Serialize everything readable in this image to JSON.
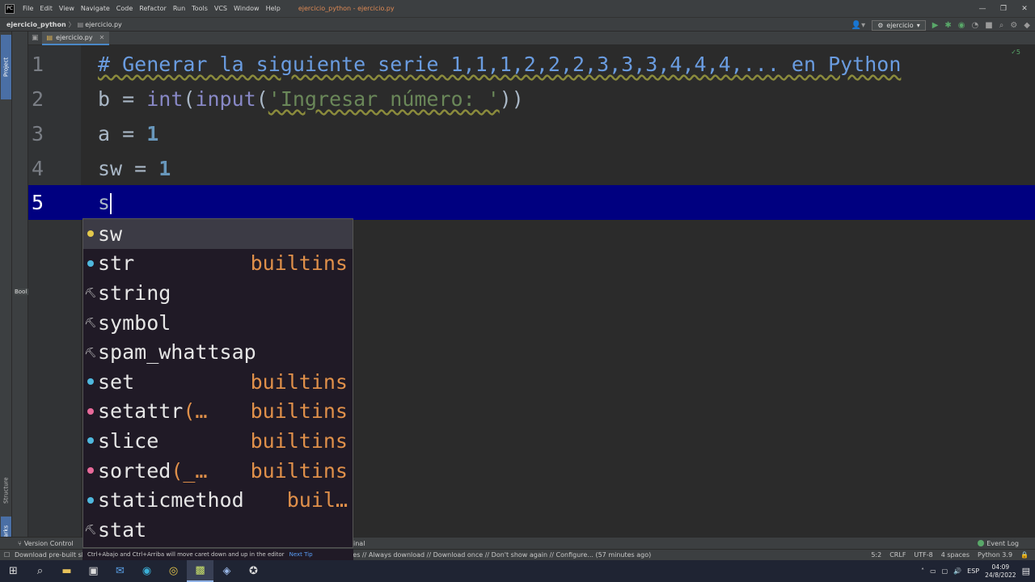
{
  "titlebar": {
    "app_icon": "PC",
    "menu": [
      "File",
      "Edit",
      "View",
      "Navigate",
      "Code",
      "Refactor",
      "Run",
      "Tools",
      "VCS",
      "Window",
      "Help"
    ],
    "window_title": "ejercicio_python - ejercicio.py"
  },
  "navbar": {
    "project": "ejercicio_python",
    "file": "ejercicio.py",
    "run_config": "ejercicio"
  },
  "left_strip": {
    "project_tab": "Project",
    "structure_tab": "Structure",
    "bookmarks_tab": "Bookmarks",
    "bookmarks_panel": "Bool"
  },
  "editor_tab": {
    "label": "ejercicio.py"
  },
  "editor": {
    "inspection": "✓5",
    "lines": [
      {
        "num": "1",
        "code": "# Generar la siguiente serie 1,1,1,2,2,2,3,3,3,4,4,4,... en Python"
      },
      {
        "num": "2",
        "p1": "b = ",
        "p2": "int",
        "p3": "(",
        "p4": "input",
        "p5": "(",
        "p6": "'Ingresar número: '",
        "p7": "))"
      },
      {
        "num": "3",
        "p1": "a = ",
        "p2": "1"
      },
      {
        "num": "4",
        "p1": "sw = ",
        "p2": "1"
      },
      {
        "num": "5",
        "p1": "s"
      }
    ]
  },
  "completion": {
    "items": [
      {
        "name": "sw",
        "tail": "",
        "type": "",
        "kind": "variable"
      },
      {
        "name": "str",
        "tail": "",
        "type": "builtins",
        "kind": "class"
      },
      {
        "name": "string",
        "tail": "",
        "type": "",
        "kind": "module"
      },
      {
        "name": "symbol",
        "tail": "",
        "type": "",
        "kind": "module"
      },
      {
        "name": "spam_whattsap",
        "tail": "",
        "type": "",
        "kind": "module"
      },
      {
        "name": "set",
        "tail": "",
        "type": "builtins",
        "kind": "class"
      },
      {
        "name": "setattr",
        "tail": "(…",
        "type": "builtins",
        "kind": "function"
      },
      {
        "name": "slice",
        "tail": "",
        "type": "builtins",
        "kind": "class"
      },
      {
        "name": "sorted",
        "tail": "(_…",
        "type": "builtins",
        "kind": "function"
      },
      {
        "name": "staticmethod",
        "tail": "",
        "type": "buil…",
        "kind": "class"
      },
      {
        "name": "stat",
        "tail": "",
        "type": "",
        "kind": "module"
      }
    ],
    "tip": "Ctrl+Abajo and Ctrl+Arriba will move caret down and up in the editor",
    "tip_next": "Next Tip"
  },
  "bottom_tools": {
    "version_control": "Version Control",
    "terminal_fragment": "inal",
    "event_log": "Event Log"
  },
  "statusbar": {
    "message": "Download pre-built sha",
    "message2": "exes // Always download // Download once // Don't show again // Configure... (57 minutes ago)",
    "caret_pos": "5:2",
    "line_sep": "CRLF",
    "encoding": "UTF-8",
    "indent": "4 spaces",
    "interpreter": "Python 3.9"
  },
  "taskbar": {
    "lang": "ESP",
    "time": "04:09",
    "date": "24/8/2022"
  },
  "colors": {
    "accent": "#4a88c7",
    "current_line": "#000080",
    "popup_bg": "#201a26",
    "type_orange": "#e0904a"
  }
}
